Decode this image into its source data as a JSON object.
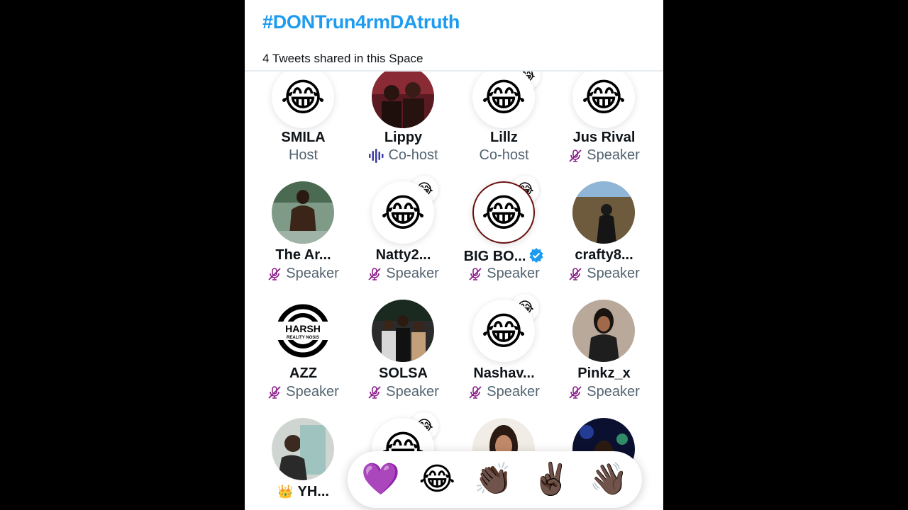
{
  "space": {
    "title": "#DONTrun4rmDAtruth",
    "tweets_shared": "4 Tweets shared in this Space"
  },
  "participants": [
    {
      "name": "SMILA",
      "role": "Host",
      "avatar": "😂"
    },
    {
      "name": "Lippy",
      "role": "Co-host",
      "speaking": true
    },
    {
      "name": "Lillz",
      "role": "Co-host",
      "avatar": "😂"
    },
    {
      "name": "Jus Rival",
      "role": "Speaker",
      "muted": true,
      "avatar": "😂"
    },
    {
      "name": "The Ar...",
      "role": "Speaker",
      "muted": true
    },
    {
      "name": "Natty2...",
      "role": "Speaker",
      "muted": true,
      "avatar": "😂"
    },
    {
      "name": "BIG BO...",
      "role": "Speaker",
      "muted": true,
      "verified": true,
      "avatar": "😂"
    },
    {
      "name": "crafty8...",
      "role": "Speaker",
      "muted": true
    },
    {
      "name": "AZZ",
      "role": "Speaker",
      "muted": true,
      "logo_text": "HARSH",
      "logo_subtext": "REALITY NOSIS"
    },
    {
      "name": "SOLSA",
      "role": "Speaker",
      "muted": true
    },
    {
      "name": "Nashav...",
      "role": "Speaker",
      "muted": true,
      "avatar": "😂"
    },
    {
      "name": "Pinkz_x",
      "role": "Speaker",
      "muted": true
    },
    {
      "name": "YH...",
      "badge": "👑"
    }
  ],
  "reactions": [
    {
      "emoji": "💜",
      "icon": "purple-heart-icon"
    },
    {
      "emoji": "😂",
      "icon": "laughing-tears-icon"
    },
    {
      "emoji": "👏🏿",
      "icon": "clapping-hands-icon"
    },
    {
      "emoji": "✌🏿",
      "icon": "victory-hand-icon"
    },
    {
      "emoji": "👋🏿",
      "icon": "waving-hand-icon"
    }
  ],
  "colors": {
    "accent": "#1d9bf0",
    "muted_icon": "#8b1f8b",
    "speaking_icon": "#3b3ba5",
    "secondary_text": "#536471"
  }
}
